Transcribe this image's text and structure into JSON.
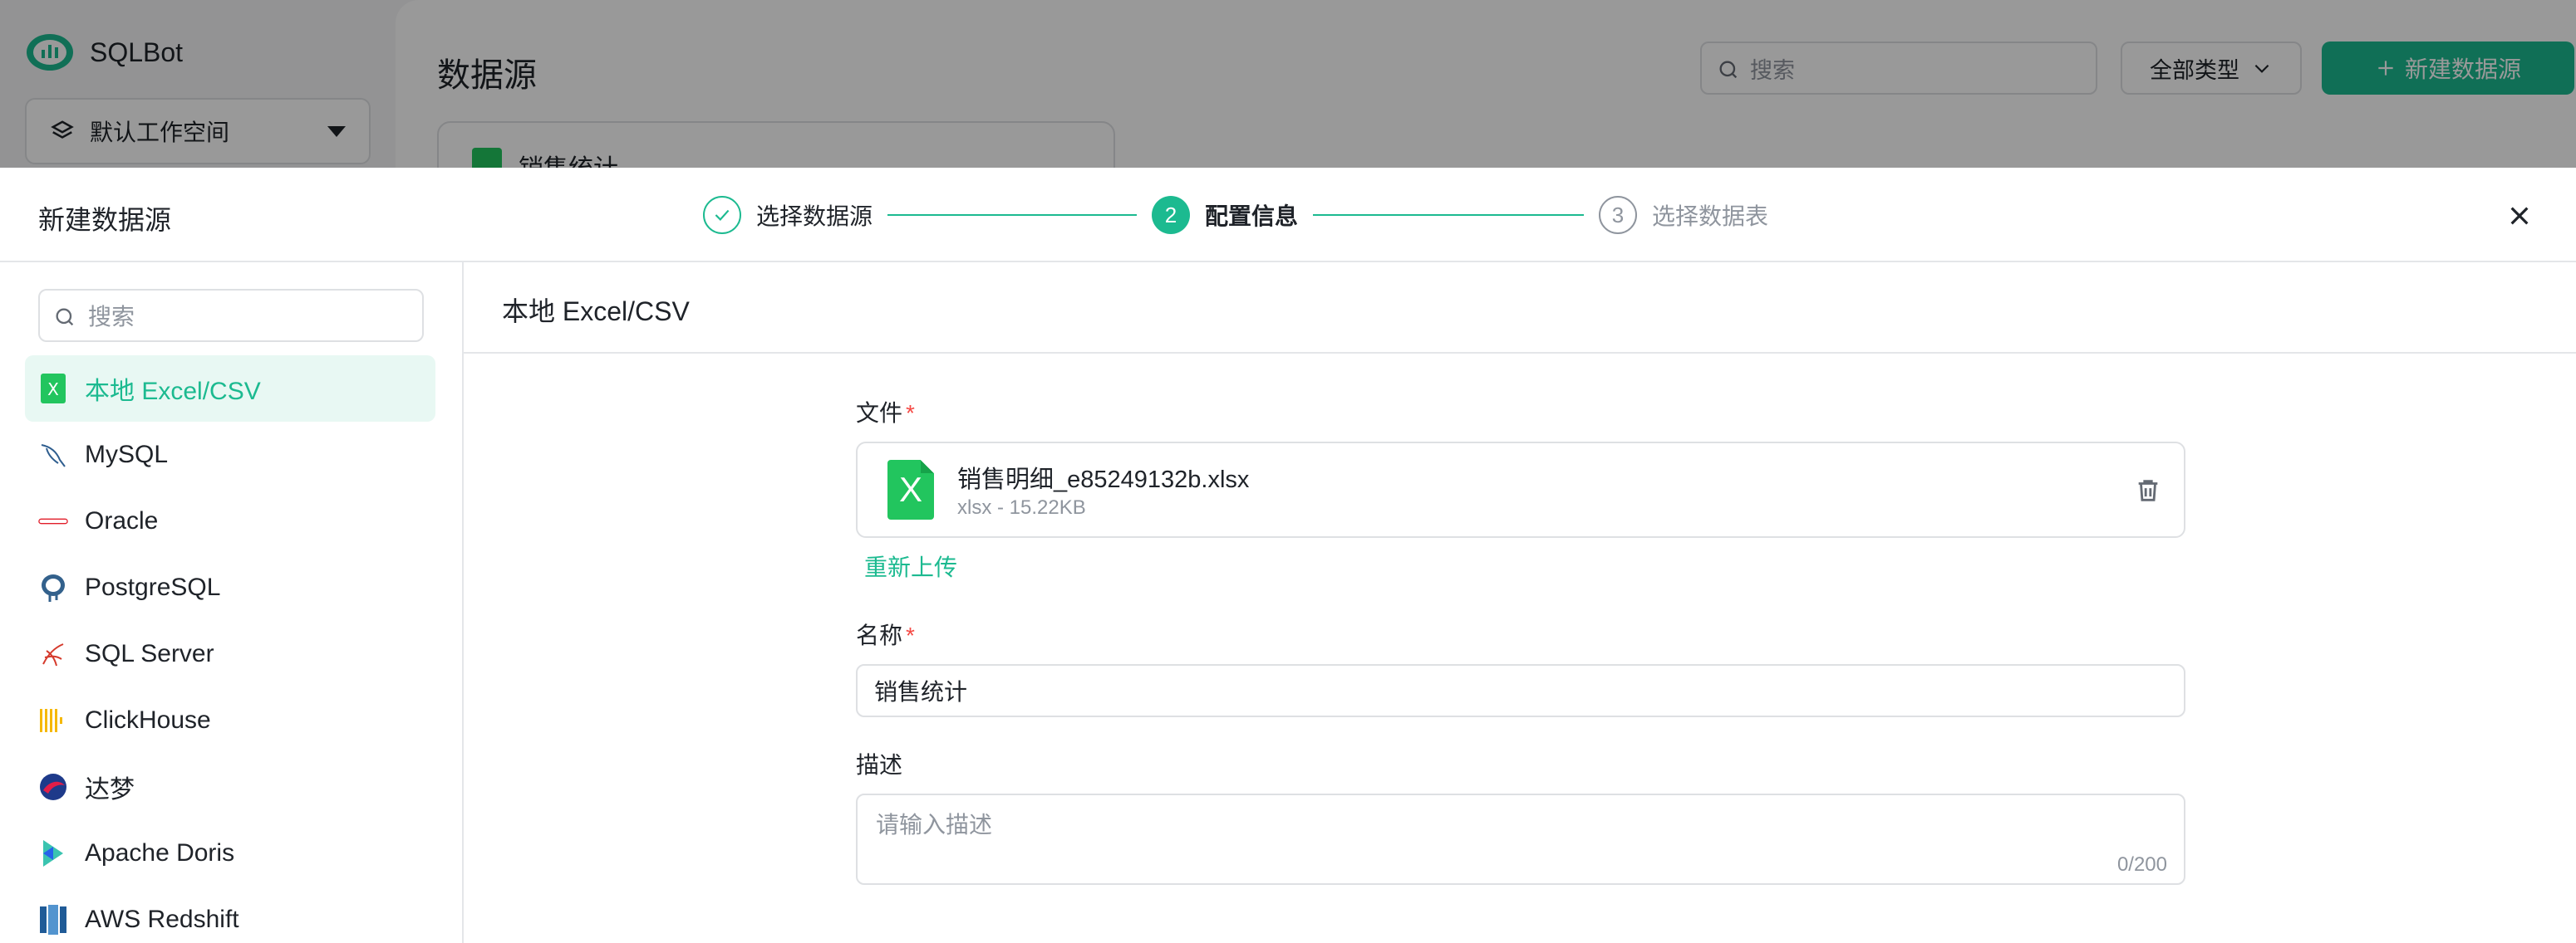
{
  "app": {
    "name": "SQLBot",
    "workspace": "默认工作空间",
    "page_title": "数据源",
    "search_placeholder": "搜索",
    "type_filter": "全部类型",
    "new_button": "新建数据源",
    "bg_card_title": "销售统计",
    "accent_color": "#1cba90"
  },
  "drawer": {
    "title": "新建数据源",
    "steps": [
      {
        "label": "选择数据源",
        "state": "done",
        "number": "1"
      },
      {
        "label": "配置信息",
        "state": "active",
        "number": "2"
      },
      {
        "label": "选择数据表",
        "state": "todo",
        "number": "3"
      }
    ]
  },
  "datasources": {
    "search_placeholder": "搜索",
    "items": [
      {
        "label": "本地 Excel/CSV",
        "icon": "excel-icon",
        "selected": true
      },
      {
        "label": "MySQL",
        "icon": "mysql-icon"
      },
      {
        "label": "Oracle",
        "icon": "oracle-icon"
      },
      {
        "label": "PostgreSQL",
        "icon": "postgresql-icon"
      },
      {
        "label": "SQL Server",
        "icon": "sqlserver-icon"
      },
      {
        "label": "ClickHouse",
        "icon": "clickhouse-icon"
      },
      {
        "label": "达梦",
        "icon": "dameng-icon"
      },
      {
        "label": "Apache Doris",
        "icon": "doris-icon"
      },
      {
        "label": "AWS Redshift",
        "icon": "redshift-icon"
      }
    ]
  },
  "config": {
    "title": "本地 Excel/CSV",
    "file_label": "文件",
    "file_name": "销售明细_e85249132b.xlsx",
    "file_meta": "xlsx - 15.22KB",
    "file_icon_letter": "X",
    "reupload": "重新上传",
    "name_label": "名称",
    "name_value": "销售统计",
    "desc_label": "描述",
    "desc_placeholder": "请输入描述",
    "desc_count": "0/200",
    "required_mark": "*"
  }
}
